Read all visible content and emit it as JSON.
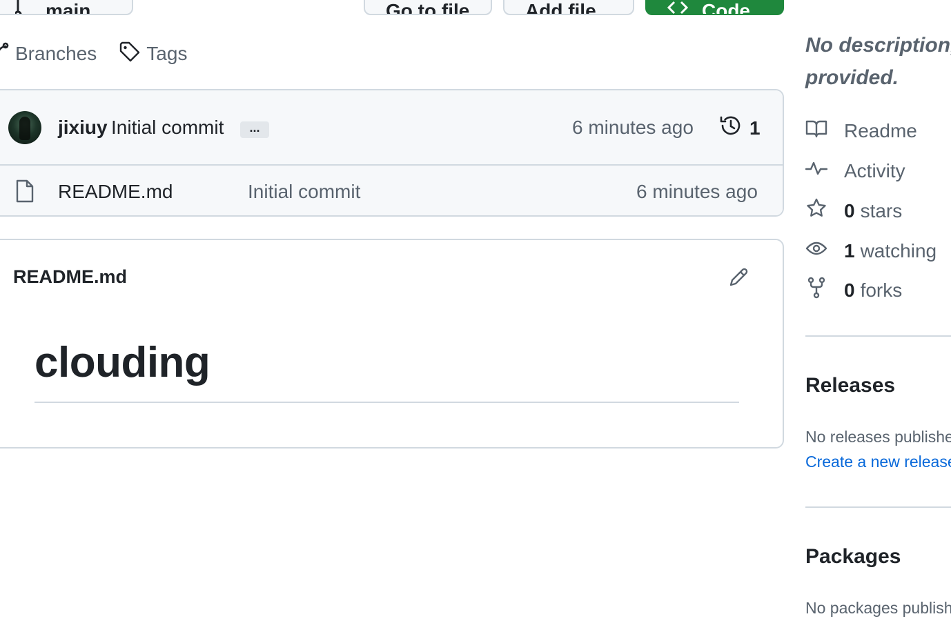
{
  "toolbar": {
    "branch_label": "main",
    "goto_label": "Go to file",
    "add_label": "Add file",
    "code_label": "Code"
  },
  "meta": {
    "branches_label": "Branches",
    "tags_label": "Tags"
  },
  "commit": {
    "author": "jixiuy",
    "message": "Initial commit",
    "more": "...",
    "time": "6 minutes ago",
    "history_count": "1"
  },
  "files": [
    {
      "name": "README.md",
      "message": "Initial commit",
      "time": "6 minutes ago"
    }
  ],
  "readme": {
    "title": "README.md",
    "heading": "clouding"
  },
  "sidebar": {
    "description_line1": "No description,",
    "description_line2": "provided.",
    "readme_label": "Readme",
    "activity_label": "Activity",
    "stars_count": "0",
    "stars_label": "stars",
    "watching_count": "1",
    "watching_label": "watching",
    "forks_count": "0",
    "forks_label": "forks",
    "releases_heading": "Releases",
    "releases_note": "No releases published",
    "releases_cta": "Create a new release",
    "packages_heading": "Packages",
    "packages_note": "No packages published"
  },
  "colors": {
    "code_button": "#1f883d",
    "link": "#0969da",
    "muted_text": "#59636e",
    "border": "#d1d9e0"
  },
  "icons": [
    "branch-icon",
    "tag-icon",
    "history-icon",
    "file-icon",
    "pencil-icon",
    "book-icon",
    "pulse-icon",
    "star-icon",
    "eye-icon",
    "fork-icon",
    "code-icon"
  ]
}
